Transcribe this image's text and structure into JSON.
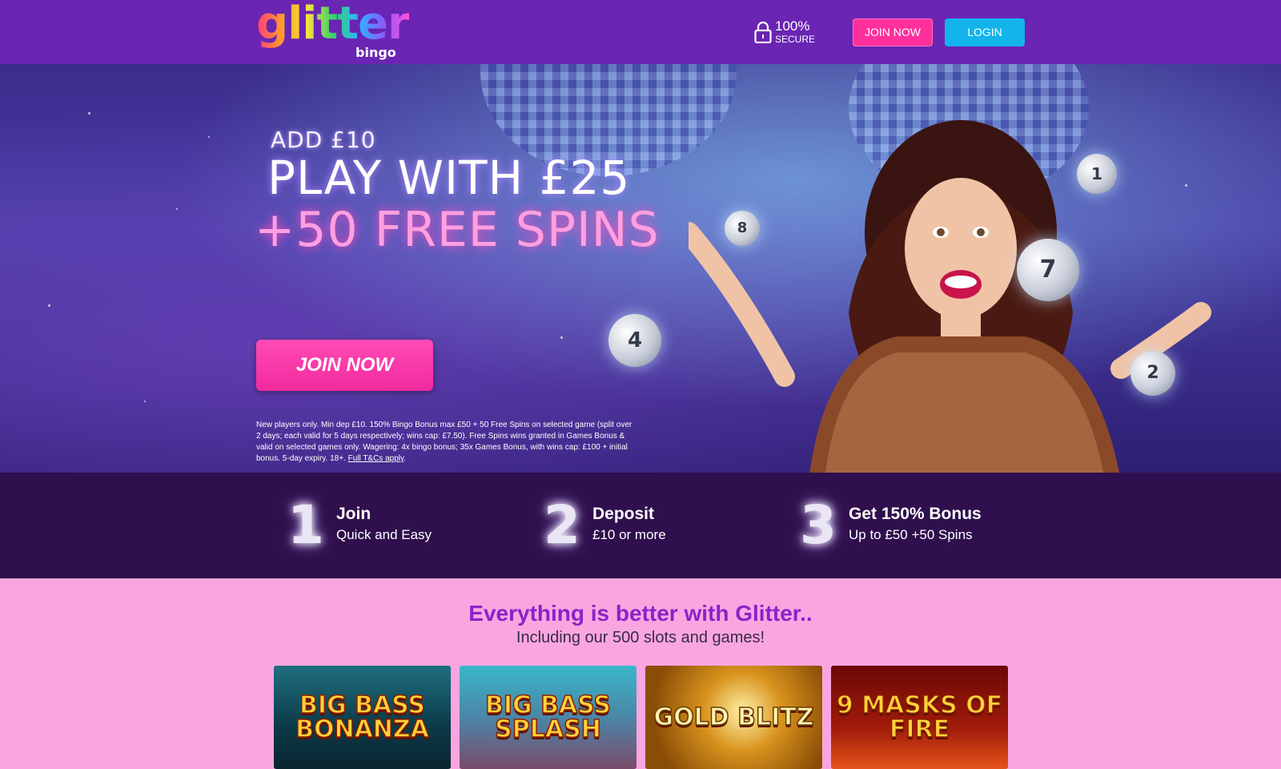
{
  "header": {
    "logo_text": "glitter",
    "logo_sub": "bingo",
    "secure_percent": "100%",
    "secure_label": "SECURE",
    "join_label": "JOIN NOW",
    "login_label": "LOGIN",
    "colors": {
      "bar": "#6a25b3",
      "join": "#ff2f9c",
      "login": "#13b4ec"
    }
  },
  "hero": {
    "line1": "ADD £10",
    "line2": "PLAY WITH £25",
    "line3": "+50 FREE SPINS",
    "join_label": "JOIN NOW",
    "terms": "New players only. Min dep £10. 150% Bingo Bonus max £50 + 50 Free Spins on selected game (split over 2 days; each valid for 5 days respectively; wins cap: £7.50). Free Spins wins granted in Games Bonus & valid on selected games only. Wagering: 4x bingo bonus; 35x Games Bonus, with wins cap: £100 + initial bonus. 5-day expiry. 18+.",
    "terms_link": "Full T&Cs apply",
    "balls": [
      "8",
      "1",
      "7",
      "4",
      "2"
    ]
  },
  "steps": [
    {
      "num": "1",
      "title": "Join",
      "sub": "Quick and Easy"
    },
    {
      "num": "2",
      "title": "Deposit",
      "sub": "£10 or more"
    },
    {
      "num": "3",
      "title": "Get 150% Bonus",
      "sub": "Up to £50 +50 Spins"
    }
  ],
  "games_section": {
    "title": "Everything is better with Glitter..",
    "subtitle": "Including our 500 slots and games!",
    "games": [
      "BIG BASS BONANZA",
      "BIG BASS SPLASH",
      "GOLD BLITZ",
      "9 MASKS OF FIRE"
    ]
  }
}
